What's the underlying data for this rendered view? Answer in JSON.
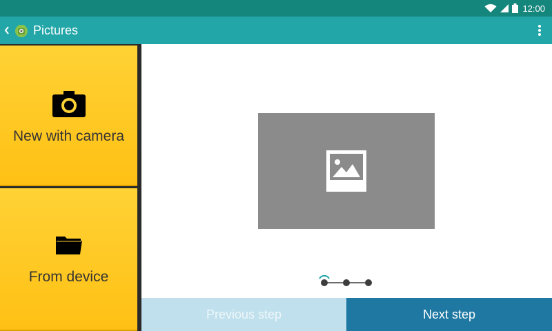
{
  "status_bar": {
    "time": "12:00"
  },
  "action_bar": {
    "title": "Pictures"
  },
  "left_panel": {
    "camera_tile": {
      "label": "New with camera"
    },
    "device_tile": {
      "label": "From device"
    }
  },
  "stepper": {
    "total_steps": 3,
    "current_step": 1
  },
  "footer": {
    "previous_label": "Previous step",
    "next_label": "Next step"
  },
  "colors": {
    "status_bar": "#15867c",
    "action_bar": "#22a6a8",
    "tile": "#ffc72a",
    "next_button": "#1e78a2",
    "previous_button_disabled": "#bfe0ec"
  }
}
